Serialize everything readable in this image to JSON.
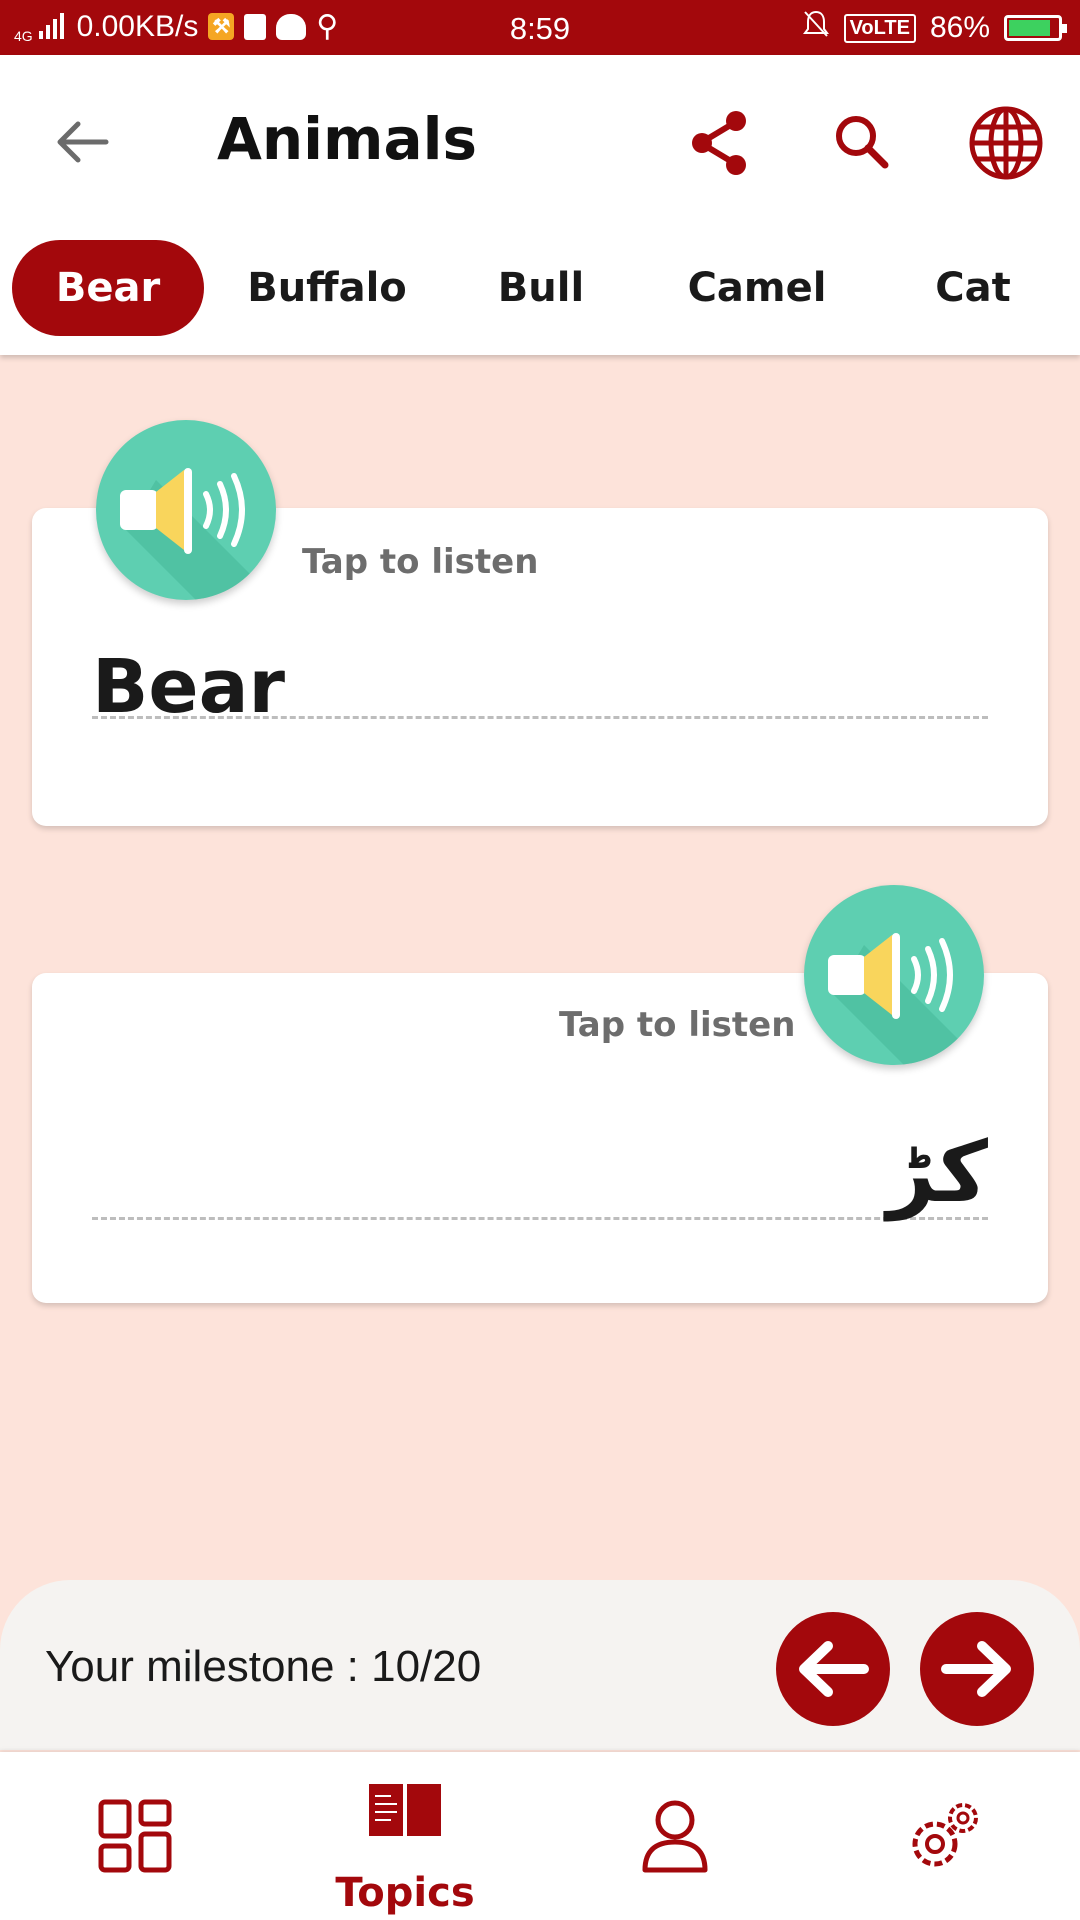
{
  "status_bar": {
    "network": "4G",
    "speed": "0.00KB/s",
    "time": "8:59",
    "volte": "VoLTE",
    "battery": "86%",
    "battery_level": 0.86
  },
  "header": {
    "title": "Animals"
  },
  "tabs": [
    {
      "label": "Bear",
      "active": true
    },
    {
      "label": "Buffalo",
      "active": false
    },
    {
      "label": "Bull",
      "active": false
    },
    {
      "label": "Camel",
      "active": false
    },
    {
      "label": "Cat",
      "active": false
    }
  ],
  "cards": {
    "english": {
      "listen_label": "Tap to listen",
      "word": "Bear"
    },
    "urdu": {
      "listen_label": "Tap to listen",
      "word": "کڑ"
    }
  },
  "milestone": {
    "label": "Your milestone : 10/20",
    "current": 10,
    "total": 20
  },
  "bottom_nav": [
    {
      "icon": "dashboard-icon",
      "label": ""
    },
    {
      "icon": "book-icon",
      "label": "Topics"
    },
    {
      "icon": "profile-icon",
      "label": ""
    },
    {
      "icon": "settings-icon",
      "label": ""
    }
  ],
  "colors": {
    "brand": "#a3080c",
    "background": "#fde3da",
    "speaker": "#5ecfb1"
  }
}
